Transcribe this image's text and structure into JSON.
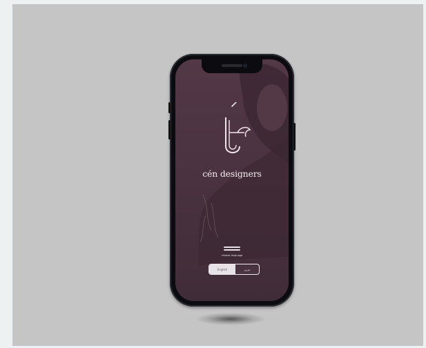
{
  "app": {
    "brand_name": "cén designers"
  },
  "language": {
    "title": "choose language",
    "options": [
      "English",
      "عربي"
    ],
    "selected": "English"
  },
  "colors": {
    "screen": "#4a3340",
    "card": "#c5c5c5",
    "page": "#eef1f2",
    "text": "#f1ecef"
  }
}
